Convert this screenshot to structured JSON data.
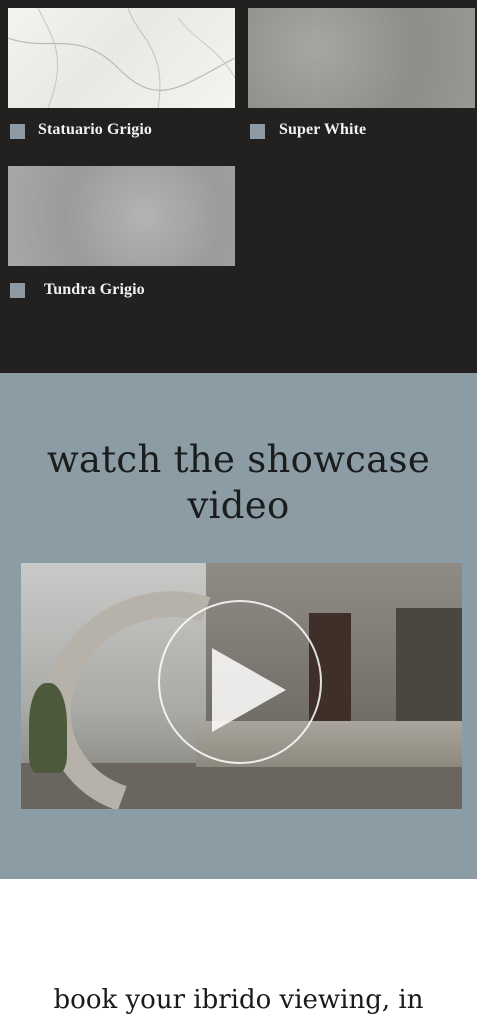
{
  "materials": [
    {
      "name": "Statuario Grigio"
    },
    {
      "name": "Super White"
    },
    {
      "name": "Tundra Grigio"
    }
  ],
  "video_section": {
    "heading_line1": "watch the showcase",
    "heading_line2": "video",
    "play_icon": "play-icon"
  },
  "booking": {
    "text": "book your ibrido viewing, in"
  },
  "colors": {
    "dark_bg": "#222120",
    "band_bg": "#8c9ca5",
    "check_color": "#8e9aa3"
  }
}
